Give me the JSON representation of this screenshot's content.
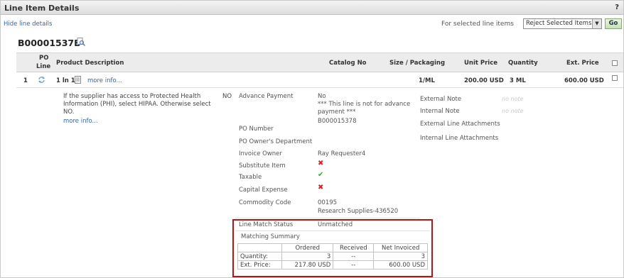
{
  "panel": {
    "title": "Line Item Details",
    "help": "?"
  },
  "toolbar": {
    "hide_link": "Hide line details",
    "selected_label": "For selected line items",
    "action_select": "Reject Selected Items",
    "go_label": "Go"
  },
  "po": {
    "number": "B00001537B"
  },
  "table": {
    "headers": {
      "po_line_top": "PO",
      "po_line_bottom": "Line",
      "product_description": "Product Description",
      "catalog_no": "Catalog No",
      "size_packaging": "Size / Packaging",
      "unit_price": "Unit Price",
      "quantity": "Quantity",
      "ext_price": "Ext. Price"
    },
    "row": {
      "index": "1",
      "line_label": "1 ln 1",
      "more_info": "more info...",
      "size": "1/ML",
      "unit_price": "200.00 USD",
      "quantity": "3 ML",
      "ext_price": "600.00 USD"
    }
  },
  "detail": {
    "question": "If the supplier has access to Protected Health Information (PHI), select HIPAA. Otherwise select NO.",
    "answer": "NO",
    "more_info": "more info...",
    "fields": {
      "advance_payment_label": "Advance Payment",
      "advance_payment_value": "No",
      "advance_payment_note": "*** This line is not for advance payment ***",
      "po_number_label": "PO Number",
      "po_number_value": "B000015378",
      "po_owner_dept_label": "PO Owner's Department",
      "invoice_owner_label": "Invoice Owner",
      "invoice_owner_value": "Ray Requester4",
      "substitute_item_label": "Substitute Item",
      "taxable_label": "Taxable",
      "capital_expense_label": "Capital Expense",
      "commodity_code_label": "Commodity Code",
      "commodity_code_value": "00195",
      "commodity_code_desc": "Research Supplies-436520",
      "line_match_status_label": "Line Match Status",
      "line_match_status_value": "Unmatched",
      "matching_summary_label": "Matching Summary"
    },
    "right": {
      "external_note_label": "External Note",
      "external_note_value": "no note",
      "internal_note_label": "Internal Note",
      "internal_note_value": "no note",
      "external_attachments_label": "External Line Attachments",
      "internal_attachments_label": "Internal Line Attachments"
    },
    "matching_summary": {
      "col_ordered": "Ordered",
      "col_received": "Received",
      "col_net_invoiced": "Net Invoiced",
      "row_quantity_label": "Quantity:",
      "row_quantity_ordered": "3",
      "row_quantity_received": "--",
      "row_quantity_net": "3",
      "row_price_label": "Ext. Price:",
      "row_price_ordered": "217.80 USD",
      "row_price_received": "--",
      "row_price_net": "600.00 USD"
    }
  },
  "colors": {
    "highlight": "#b01818",
    "link": "#3366aa",
    "cross": "#dd2222",
    "check": "#33aa33"
  }
}
